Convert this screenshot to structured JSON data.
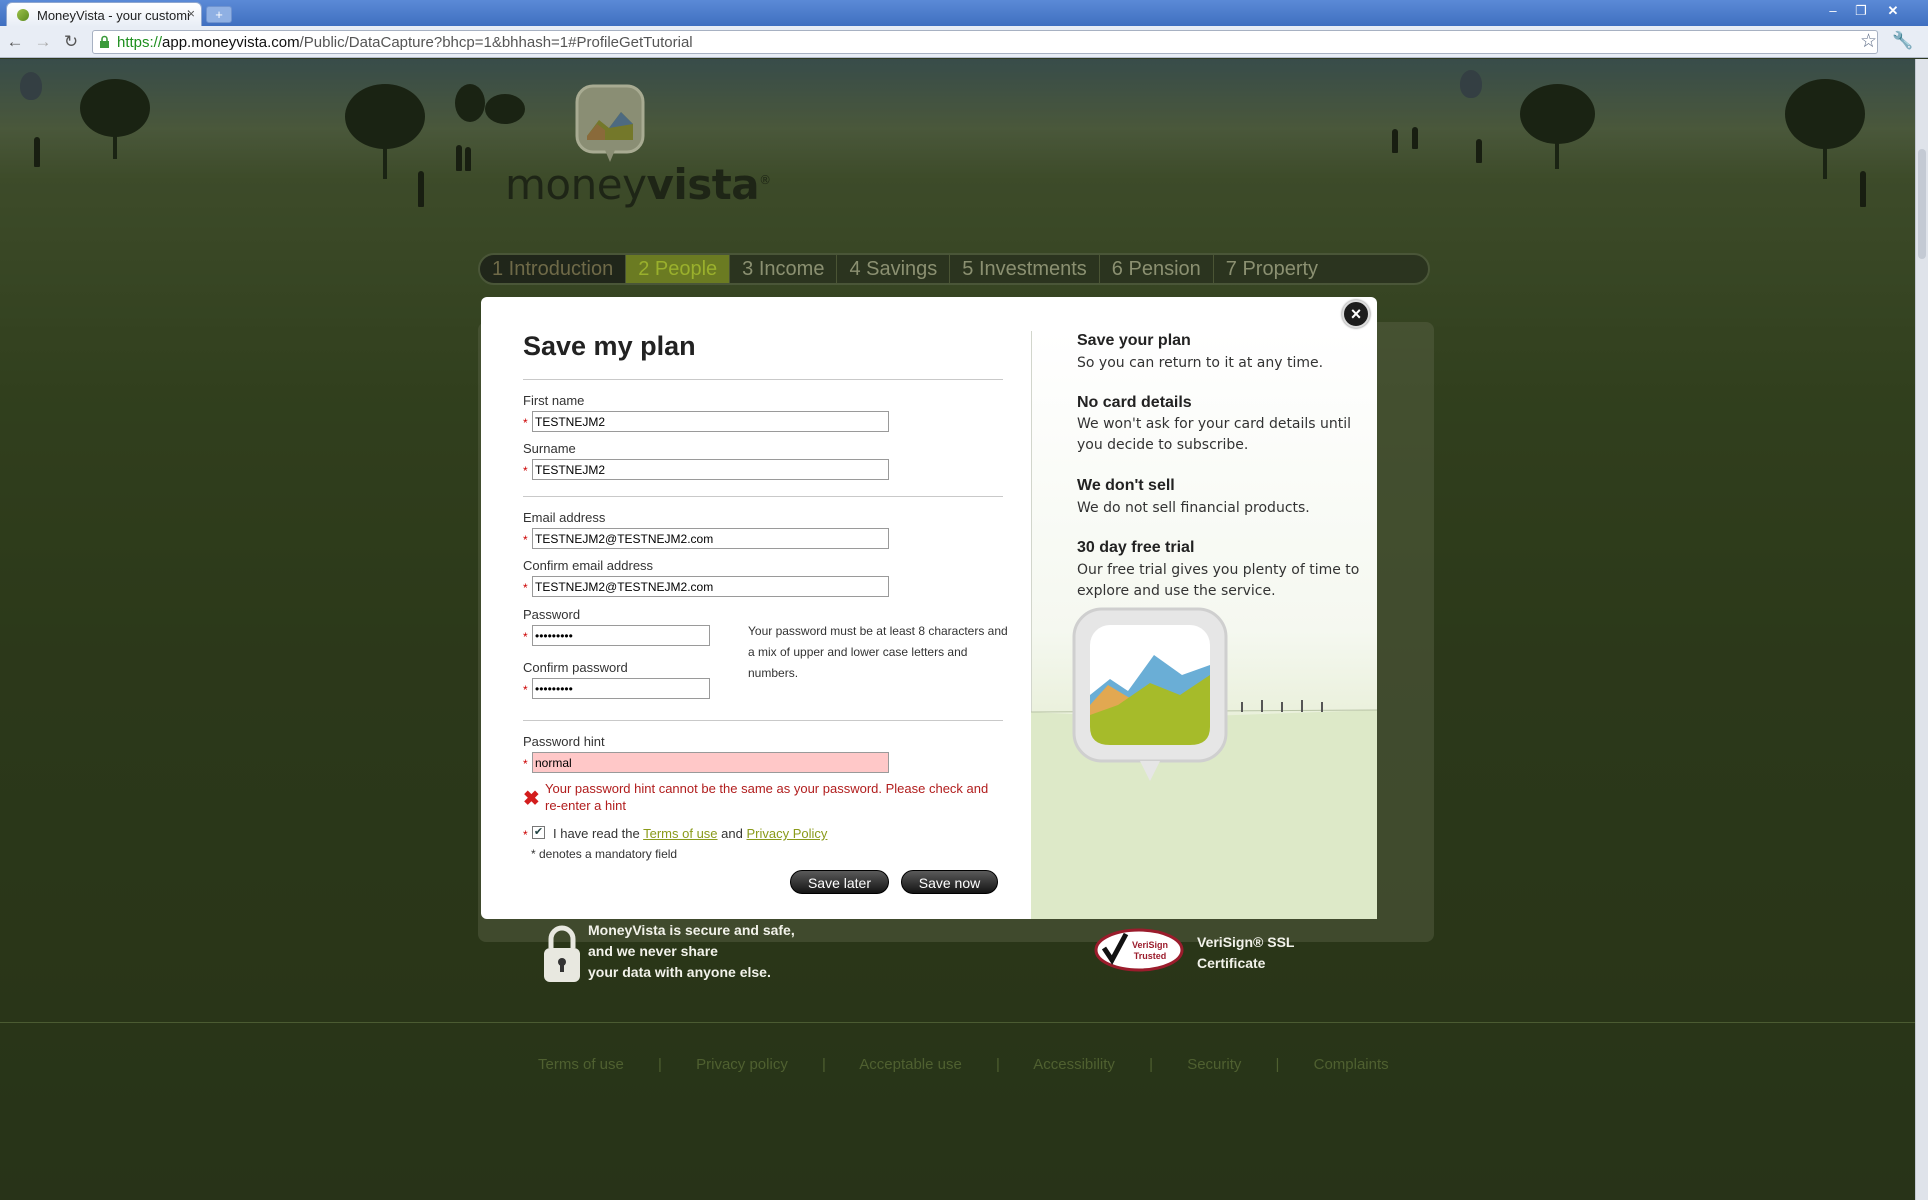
{
  "browser": {
    "tab_title": "MoneyVista - your customi",
    "tab_close": "×",
    "new_tab": "+",
    "url_scheme": "https://",
    "url_host": "app.moneyvista.com",
    "url_path": "/Public/DataCapture?bhcp=1&bhhash=1#ProfileGetTutorial",
    "back_icon": "back-arrow-icon",
    "forward_icon": "forward-arrow-icon",
    "reload_icon": "reload-icon"
  },
  "site": {
    "logo_text_light": "money",
    "logo_text_bold": "vista",
    "logo_mark": "®",
    "steps": [
      {
        "label": "1 Introduction",
        "state": "done"
      },
      {
        "label": "2 People",
        "state": "current"
      },
      {
        "label": "3 Income",
        "state": "pending"
      },
      {
        "label": "4 Savings",
        "state": "pending"
      },
      {
        "label": "5 Investments",
        "state": "pending"
      },
      {
        "label": "6 Pension",
        "state": "pending"
      },
      {
        "label": "7 Property",
        "state": "pending"
      }
    ],
    "secure_lines": [
      "MoneyVista is secure and safe,",
      "and we never share",
      "your data with anyone else."
    ],
    "verisign_lines": [
      "VeriSign® SSL",
      "Certificate"
    ],
    "verisign_seal_text": "VeriSign Trusted",
    "footer_links": [
      "Terms of use",
      "|",
      "Privacy policy",
      "|",
      "Acceptable use",
      "|",
      "Accessibility",
      "|",
      "Security",
      "|",
      "Complaints"
    ]
  },
  "modal": {
    "close": "×",
    "title": "Save my plan",
    "first_name_label": "First name",
    "first_name_value": "TESTNEJM2",
    "surname_label": "Surname",
    "surname_value": "TESTNEJM2",
    "email_label": "Email address",
    "email_value": "TESTNEJM2@TESTNEJM2.com",
    "confirm_email_label": "Confirm email address",
    "confirm_email_value": "TESTNEJM2@TESTNEJM2.com",
    "password_label": "Password",
    "password_value": "•••••••••",
    "confirm_password_label": "Confirm password",
    "confirm_password_value": "•••••••••",
    "password_note": "Your password must be at least 8 characters and a mix of upper and lower case letters and numbers.",
    "hint_label": "Password hint",
    "hint_value": "normal",
    "hint_error": "Your password hint cannot be the same as your password. Please check and re-enter a hint",
    "required_mark": "*",
    "agree_prefix": "I have read the",
    "terms_link": "Terms of use",
    "agree_and": "and",
    "privacy_link": "Privacy Policy",
    "agree_checked": true,
    "mandatory_note": "* denotes a mandatory field",
    "save_later": "Save later",
    "save_now": "Save now",
    "info": [
      {
        "heading": "Save your plan",
        "text": "So you can return to it at any time."
      },
      {
        "heading": "No card details",
        "text": "We won't ask for your card details until you decide to subscribe."
      },
      {
        "heading": "We don't sell",
        "text": "We do not sell financial products."
      },
      {
        "heading": "30 day free trial",
        "text": "Our free trial gives you plenty of time to explore and use the service."
      }
    ]
  },
  "colors": {
    "error_red": "#b11d1d",
    "error_field": "#ffc8c8",
    "link_green": "#8a9a1a",
    "current_step": "#9ab02c"
  }
}
